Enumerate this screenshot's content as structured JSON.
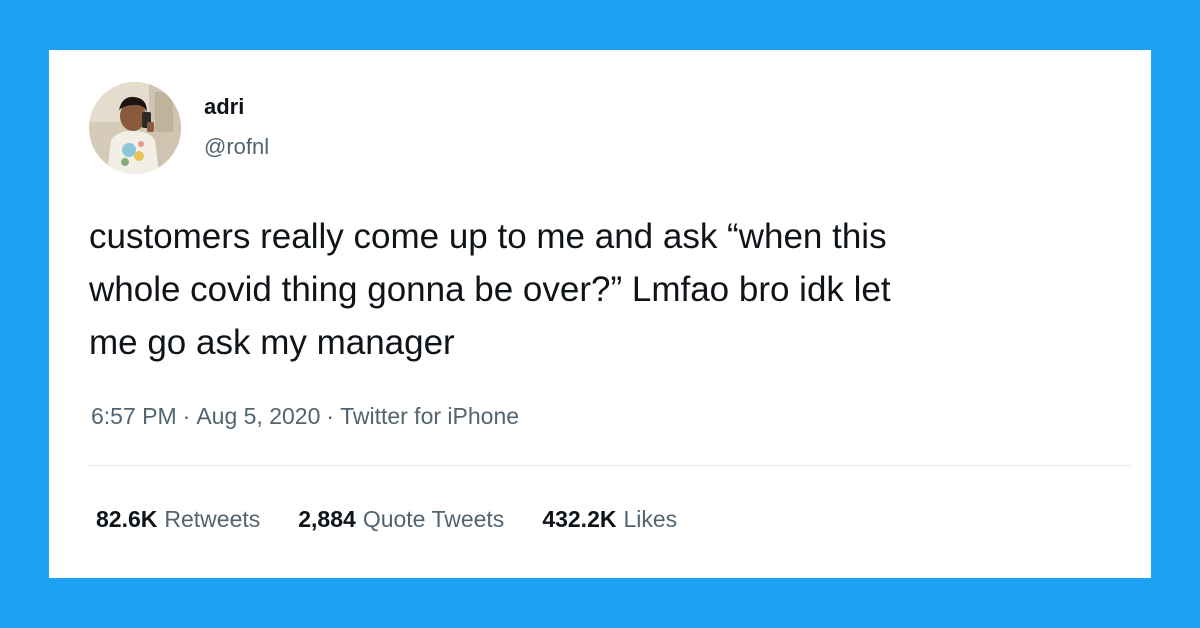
{
  "tweet": {
    "display_name": "adri",
    "handle": "@rofnl",
    "text_lines": [
      "customers really come up to me and ask “when this",
      "whole covid thing gonna be over?” Lmfao bro idk let",
      "me go ask my manager"
    ],
    "time": "6:57 PM",
    "date": "Aug 5, 2020",
    "source": "Twitter for iPhone",
    "separator": "·"
  },
  "stats": {
    "retweets_count": "82.6K",
    "retweets_label": "Retweets",
    "quotes_count": "2,884",
    "quotes_label": "Quote Tweets",
    "likes_count": "432.2K",
    "likes_label": "Likes"
  },
  "colors": {
    "background": "#1da1f2",
    "card": "#ffffff",
    "text_primary": "#0f1419",
    "text_secondary": "#536471"
  },
  "icons": {
    "avatar": "user-photo"
  }
}
